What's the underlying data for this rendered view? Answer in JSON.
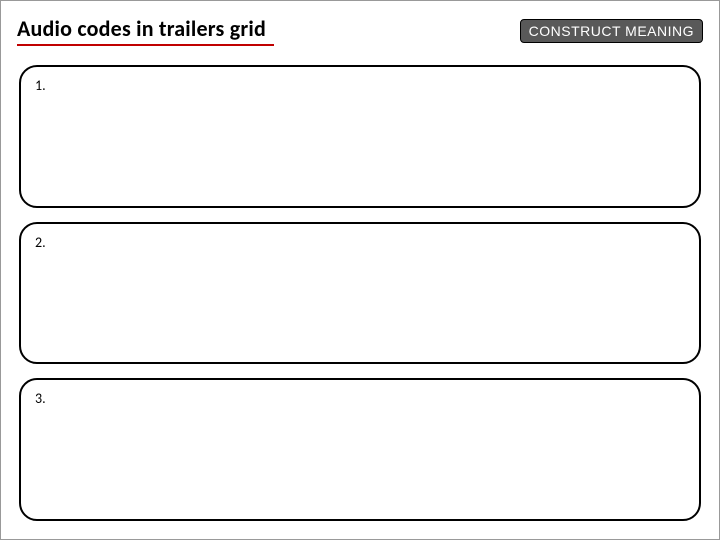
{
  "header": {
    "title": "Audio codes in trailers grid",
    "badge": "CONSTRUCT MEANING"
  },
  "boxes": [
    {
      "num": "1.",
      "content": ""
    },
    {
      "num": "2.",
      "content": ""
    },
    {
      "num": "3.",
      "content": ""
    }
  ]
}
